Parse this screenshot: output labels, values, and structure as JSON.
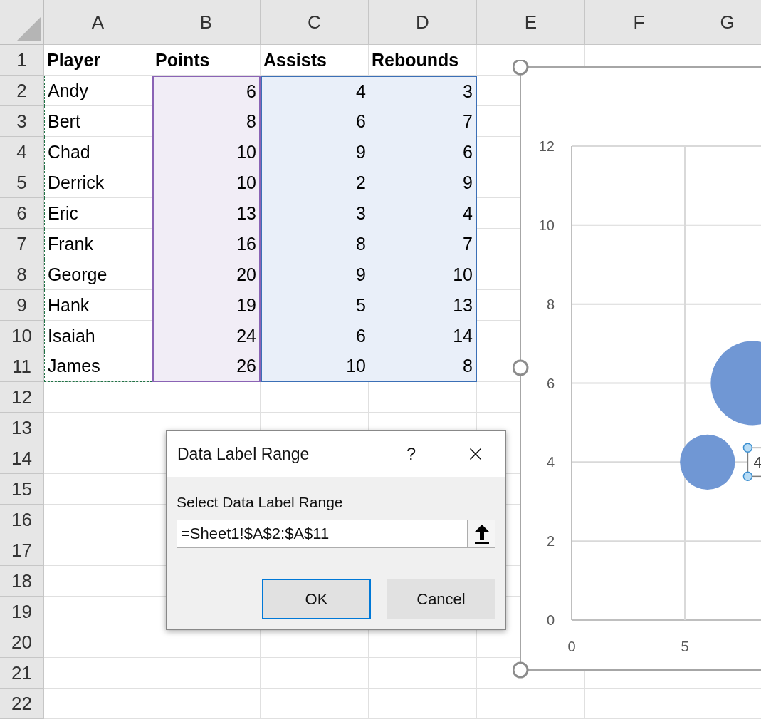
{
  "column_headers": [
    {
      "label": "A",
      "kind": "labels"
    },
    {
      "label": "B",
      "kind": "x"
    },
    {
      "label": "C",
      "kind": "values"
    },
    {
      "label": "D",
      "kind": "values"
    },
    {
      "label": "E",
      "kind": "plain"
    },
    {
      "label": "F",
      "kind": "plain"
    },
    {
      "label": "G",
      "kind": "plain"
    }
  ],
  "row_headers": [
    "1",
    "2",
    "3",
    "4",
    "5",
    "6",
    "7",
    "8",
    "9",
    "10",
    "11",
    "12",
    "13",
    "14",
    "15",
    "16",
    "17",
    "18",
    "19",
    "20",
    "21",
    "22"
  ],
  "rows": [
    [
      "Player",
      "Points",
      "Assists",
      "Rebounds"
    ],
    [
      "Andy",
      "6",
      "4",
      "3"
    ],
    [
      "Bert",
      "8",
      "6",
      "7"
    ],
    [
      "Chad",
      "10",
      "9",
      "6"
    ],
    [
      "Derrick",
      "10",
      "2",
      "9"
    ],
    [
      "Eric",
      "13",
      "3",
      "4"
    ],
    [
      "Frank",
      "16",
      "8",
      "7"
    ],
    [
      "George",
      "20",
      "9",
      "10"
    ],
    [
      "Hank",
      "19",
      "5",
      "13"
    ],
    [
      "Isaiah",
      "24",
      "6",
      "14"
    ],
    [
      "James",
      "26",
      "10",
      "8"
    ]
  ],
  "chart": {
    "chart_data": {
      "type": "scatter",
      "x": [
        6,
        8
      ],
      "xlim": [
        0,
        30
      ],
      "ylim": [
        0,
        12
      ],
      "xticks": [
        0,
        5
      ],
      "yticks": [
        0,
        2,
        4,
        6,
        8,
        10,
        12
      ],
      "grid": true,
      "series": [
        {
          "color": "#7097d4",
          "values": [
            4,
            6
          ]
        }
      ],
      "annotations": [
        {
          "text": "4"
        }
      ]
    }
  },
  "dialog": {
    "title": "Data Label Range",
    "help": "?",
    "label": "Select Data Label Range",
    "value": "=Sheet1!$A$2:$A$11",
    "buttons": [
      {
        "label": "OK",
        "default": true
      },
      {
        "label": "Cancel",
        "default": false
      }
    ]
  }
}
